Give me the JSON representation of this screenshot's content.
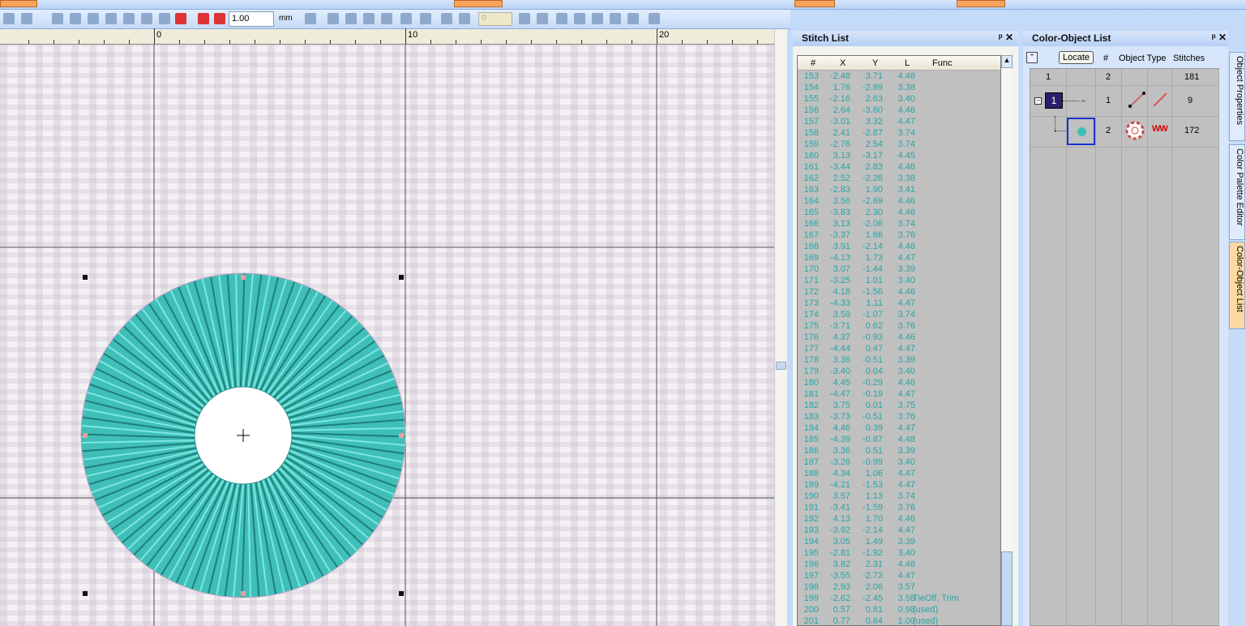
{
  "toolbar": {
    "stitch_length": "1.00",
    "unit": "mm",
    "combo_value": "0"
  },
  "ruler": {
    "labels": [
      "0",
      "10",
      "20"
    ]
  },
  "stitch_list": {
    "title": "Stitch List",
    "columns": [
      "#",
      "X",
      "Y",
      "L",
      "Func"
    ],
    "rows": [
      [
        "153",
        "-2.48",
        "3.71",
        "4.46",
        ""
      ],
      [
        "154",
        "1.76",
        "-2.89",
        "3.38",
        ""
      ],
      [
        "155",
        "-2.16",
        "2.63",
        "3.40",
        ""
      ],
      [
        "156",
        "2.64",
        "-3.60",
        "4.46",
        ""
      ],
      [
        "157",
        "-3.01",
        "3.32",
        "4.47",
        ""
      ],
      [
        "158",
        "2.41",
        "-2.87",
        "3.74",
        ""
      ],
      [
        "159",
        "-2.76",
        "2.54",
        "3.74",
        ""
      ],
      [
        "160",
        "3.13",
        "-3.17",
        "4.45",
        ""
      ],
      [
        "161",
        "-3.44",
        "2.83",
        "4.46",
        ""
      ],
      [
        "162",
        "2.52",
        "-2.26",
        "3.38",
        ""
      ],
      [
        "163",
        "-2.83",
        "1.90",
        "3.41",
        ""
      ],
      [
        "164",
        "3.56",
        "-2.69",
        "4.46",
        ""
      ],
      [
        "165",
        "-3.83",
        "2.30",
        "4.46",
        ""
      ],
      [
        "166",
        "3.13",
        "-2.06",
        "3.74",
        ""
      ],
      [
        "167",
        "-3.37",
        "1.66",
        "3.76",
        ""
      ],
      [
        "168",
        "3.91",
        "-2.14",
        "4.46",
        ""
      ],
      [
        "169",
        "-4.13",
        "1.73",
        "4.47",
        ""
      ],
      [
        "170",
        "3.07",
        "-1.44",
        "3.39",
        ""
      ],
      [
        "171",
        "-3.25",
        "1.01",
        "3.40",
        ""
      ],
      [
        "172",
        "4.18",
        "-1.56",
        "4.46",
        ""
      ],
      [
        "173",
        "-4.33",
        "1.11",
        "4.47",
        ""
      ],
      [
        "174",
        "3.59",
        "-1.07",
        "3.74",
        ""
      ],
      [
        "175",
        "-3.71",
        "0.62",
        "3.76",
        ""
      ],
      [
        "176",
        "4.37",
        "-0.93",
        "4.46",
        ""
      ],
      [
        "177",
        "-4.44",
        "0.47",
        "4.47",
        ""
      ],
      [
        "178",
        "3.36",
        "-0.51",
        "3.39",
        ""
      ],
      [
        "179",
        "-3.40",
        "0.04",
        "3.40",
        ""
      ],
      [
        "180",
        "4.45",
        "-0.29",
        "4.46",
        ""
      ],
      [
        "181",
        "-4.47",
        "-0.19",
        "4.47",
        ""
      ],
      [
        "182",
        "3.75",
        "0.01",
        "3.75",
        ""
      ],
      [
        "183",
        "-3.73",
        "-0.51",
        "3.76",
        ""
      ],
      [
        "184",
        "4.46",
        "0.39",
        "4.47",
        ""
      ],
      [
        "185",
        "-4.39",
        "-0.87",
        "4.48",
        ""
      ],
      [
        "186",
        "3.36",
        "0.51",
        "3.39",
        ""
      ],
      [
        "187",
        "-3.26",
        "-0.99",
        "3.40",
        ""
      ],
      [
        "188",
        "4.34",
        "1.06",
        "4.47",
        ""
      ],
      [
        "189",
        "-4.21",
        "-1.53",
        "4.47",
        ""
      ],
      [
        "190",
        "3.57",
        "1.13",
        "3.74",
        ""
      ],
      [
        "191",
        "-3.41",
        "-1.59",
        "3.76",
        ""
      ],
      [
        "192",
        "4.13",
        "1.70",
        "4.46",
        ""
      ],
      [
        "193",
        "-3.92",
        "-2.14",
        "4.47",
        ""
      ],
      [
        "194",
        "3.05",
        "1.49",
        "3.39",
        ""
      ],
      [
        "195",
        "-2.81",
        "-1.92",
        "3.40",
        ""
      ],
      [
        "196",
        "3.82",
        "2.31",
        "4.46",
        ""
      ],
      [
        "197",
        "-3.55",
        "-2.73",
        "4.47",
        ""
      ],
      [
        "198",
        "2.93",
        "2.06",
        "3.57",
        ""
      ],
      [
        "199",
        "-2.62",
        "-2.45",
        "3.58",
        "TieOff, Trim"
      ],
      [
        "200",
        "0.57",
        "0.81",
        "0.98",
        "(used)"
      ],
      [
        "201",
        "0.77",
        "0.64",
        "1.00",
        "(used)"
      ]
    ]
  },
  "color_object_list": {
    "title": "Color-Object List",
    "locate": "Locate",
    "headers": {
      "num": "#",
      "type": "Object Type",
      "stitches": "Stitches"
    },
    "summary": {
      "color": "1",
      "count": "2",
      "stitches": "181"
    },
    "color_block": "1",
    "objects": [
      {
        "num": "1",
        "stitches": "9"
      },
      {
        "num": "2",
        "stitches": "172"
      }
    ]
  },
  "side_tabs": [
    "Object Properties",
    "Color Palette Editor",
    "Color-Object List"
  ],
  "colors": {
    "thread": "#3fbfb8",
    "selection": "#1a2fd0",
    "color_block": "#2a1f6a"
  }
}
